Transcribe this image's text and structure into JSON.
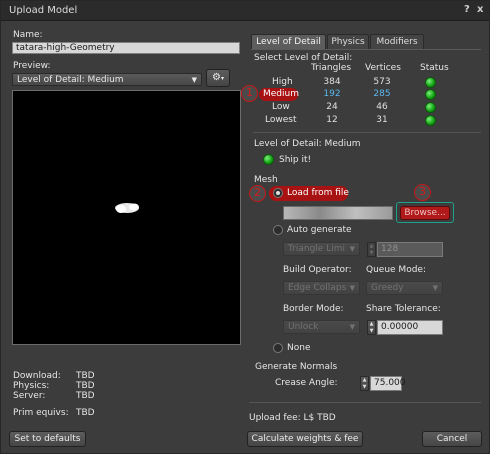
{
  "window": {
    "title": "Upload Model",
    "help_label": "?",
    "close_label": "x"
  },
  "left": {
    "name_label": "Name:",
    "name_value": "tatara-high-Geometry",
    "preview_label": "Preview:",
    "preview_select": "Level of Detail: Medium",
    "stats": [
      {
        "label": "Download:",
        "value": "TBD"
      },
      {
        "label": "Physics:",
        "value": "TBD"
      },
      {
        "label": "Server:",
        "value": "TBD"
      }
    ],
    "prim_equivs_label": "Prim equivs:",
    "prim_equivs_value": "TBD",
    "set_defaults_label": "Set to defaults"
  },
  "tabs": [
    {
      "label": "Level of Detail",
      "active": true
    },
    {
      "label": "Physics",
      "active": false
    },
    {
      "label": "Modifiers",
      "active": false
    }
  ],
  "lod": {
    "select_label": "Select Level of Detail:",
    "headers": [
      "Triangles",
      "Vertices",
      "Status"
    ],
    "rows": [
      {
        "name": "High",
        "triangles": "384",
        "vertices": "573",
        "status": "ok"
      },
      {
        "name": "Medium",
        "triangles": "192",
        "vertices": "285",
        "status": "ok"
      },
      {
        "name": "Low",
        "triangles": "24",
        "vertices": "46",
        "status": "ok"
      },
      {
        "name": "Lowest",
        "triangles": "12",
        "vertices": "31",
        "status": "ok"
      }
    ],
    "current_label": "Level of Detail: Medium",
    "ship_label": "Ship it!"
  },
  "mesh": {
    "section_label": "Mesh",
    "load_from_file_label": "Load from file",
    "browse_label": "Browse...",
    "auto_generate_label": "Auto generate",
    "triangle_limit_select": "Triangle Limi",
    "triangle_limit_value": "128",
    "build_operator_label": "Build Operator:",
    "build_operator_value": "Edge Collaps",
    "queue_mode_label": "Queue Mode:",
    "queue_mode_value": "Greedy",
    "border_mode_label": "Border Mode:",
    "border_mode_value": "Unlock",
    "share_tolerance_label": "Share Tolerance:",
    "share_tolerance_value": "0.00000",
    "none_label": "None"
  },
  "normals": {
    "section_label": "Generate Normals",
    "crease_label": "Crease Angle:",
    "crease_value": "75.000"
  },
  "footer": {
    "upload_fee": "Upload fee: L$ TBD",
    "calculate_label": "Calculate weights & fee",
    "cancel_label": "Cancel"
  },
  "annotations": {
    "one": "1",
    "two": "2",
    "three": "3"
  },
  "colors": {
    "highlight": "#a81212",
    "vertex_blue": "#58b8f0",
    "status_green": "#22c022"
  }
}
